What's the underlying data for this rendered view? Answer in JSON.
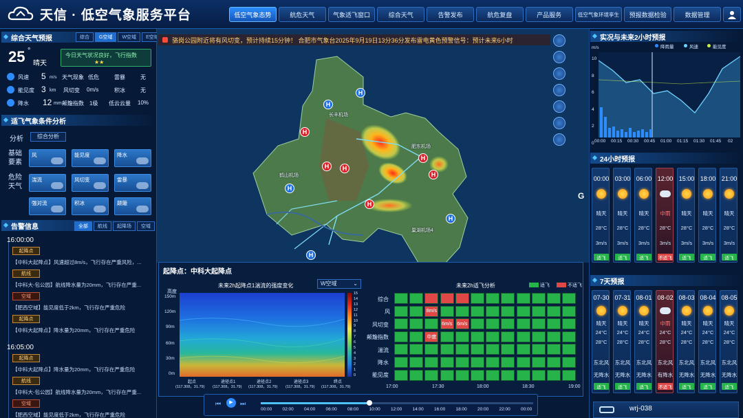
{
  "header": {
    "title": "天信 · 低空气象服务平台",
    "nav": [
      "低空气象态势",
      "航危天气",
      "气象适飞窗口",
      "综合天气",
      "告警发布",
      "航危复盘",
      "产品服务",
      "低空气象环境孪生",
      "预报数据检验",
      "数据管理"
    ],
    "active_index": 0
  },
  "left": {
    "forecast": {
      "title": "综合天气预报",
      "filters": [
        "综合",
        "G空域",
        "W空域",
        "E空域"
      ],
      "temp": "25",
      "temp_unit": "°",
      "condition": "晴天",
      "banner": "今日天气状况良好，飞行指数",
      "metrics": [
        {
          "icon": "wind-icon",
          "label": "风速",
          "value": "5",
          "unit": "m/s"
        },
        {
          "icon": "eye-icon",
          "label": "能见度",
          "value": "3",
          "unit": "km"
        },
        {
          "icon": "rain-icon",
          "label": "降水",
          "value": "12",
          "unit": "mm"
        }
      ],
      "table": [
        [
          "天气现象",
          "低危",
          "雷暴",
          "无"
        ],
        [
          "风切变",
          "0m/s",
          "积冰",
          "无"
        ],
        [
          "颠簸指数",
          "1级",
          "低云云量",
          "10%"
        ]
      ]
    },
    "suitability": {
      "title": "适飞气象条件分析",
      "analysis_label": "分析",
      "analysis_value": "综合分析",
      "basic_label": "基础要素",
      "danger_label": "危险天气",
      "basic": [
        "风",
        "能见度",
        "降水"
      ],
      "danger": [
        "湍流",
        "风切变",
        "雷暴",
        "强对流",
        "积冰",
        "颠簸"
      ]
    },
    "alerts": {
      "title": "告警信息",
      "filters": [
        "全部",
        "航线",
        "起降场",
        "空域"
      ],
      "groups": [
        {
          "time": "16:00:00",
          "items": [
            {
              "tag": "起降点",
              "text": "【中科大起降点】风速超过8m/s，飞行存在严重风险，..."
            },
            {
              "tag": "航线",
              "text": "【中科大-包公园】航线降水量为20mm，飞行存在严重..."
            },
            {
              "tag": "空域",
              "text": "【肥西空域】能见度低于2km，飞行存在严重危险"
            },
            {
              "tag": "起降点",
              "text": "【中科大起降点】降水量为20mm，飞行存在严重危险"
            }
          ]
        },
        {
          "time": "16:05:00",
          "items": [
            {
              "tag": "起降点",
              "text": "【中科大起降点】降水量为20mm，飞行存在严重危险"
            },
            {
              "tag": "航线",
              "text": "【中科大-包公园】航线降水量为20mm，飞行存在严重..."
            },
            {
              "tag": "空域",
              "text": "【肥西空域】能见度低于2km，飞行存在严重危险"
            }
          ]
        }
      ]
    }
  },
  "map": {
    "ticker": "骆岗公园附近将有风切变，预计持续15分钟！      合肥市气象台2025年9月19日13分36分发布雷电黄色预警信号：预计未来6小时",
    "labels": [
      {
        "text": "长丰机场"
      },
      {
        "text": "肥东机场"
      },
      {
        "text": "鹤山机场"
      },
      {
        "text": "巢湖机场4"
      }
    ],
    "side_letter": "G"
  },
  "analysis": {
    "title": "起降点：中科大起降点",
    "left_title": "未来2h起降点1湍流的强度变化",
    "airspace_select": "W空域",
    "y_axis_label": "高度",
    "y_ticks": [
      "150m",
      "120m",
      "90m",
      "60m",
      "30m",
      "0m"
    ],
    "colorbar": [
      "15",
      "14",
      "13",
      "12",
      "11",
      "10",
      "9",
      "8",
      "7",
      "6",
      "5",
      "4",
      "3",
      "2",
      "1",
      "0"
    ],
    "x_ticks": [
      "起点",
      "途径点1",
      "途径点2",
      "途径点3",
      "终点"
    ],
    "x_ticks_sub": "(117.308，31.79)",
    "right_title": "未来2h适飞分析",
    "legend": [
      {
        "label": "适飞",
        "color": "#26b34a"
      },
      {
        "label": "不适飞",
        "color": "#e04848"
      }
    ],
    "rows": [
      "综合",
      "风",
      "风切变",
      "颠簸指数",
      "湍流",
      "降水",
      "能见度"
    ],
    "time_ticks": [
      "17:00",
      "17:30",
      "18:00",
      "18:30",
      "19:00"
    ],
    "grid": [
      [
        0,
        0,
        1,
        1,
        1,
        0,
        0,
        0,
        0,
        0,
        0,
        0
      ],
      [
        0,
        0,
        1,
        0,
        0,
        0,
        0,
        0,
        0,
        0,
        0,
        0
      ],
      [
        0,
        0,
        0,
        1,
        1,
        0,
        0,
        0,
        0,
        0,
        0,
        0
      ],
      [
        0,
        0,
        1,
        0,
        0,
        0,
        0,
        0,
        0,
        0,
        0,
        0
      ],
      [
        0,
        0,
        0,
        0,
        0,
        0,
        0,
        0,
        0,
        0,
        0,
        0
      ],
      [
        0,
        0,
        0,
        0,
        0,
        0,
        0,
        0,
        0,
        0,
        0,
        0
      ],
      [
        0,
        0,
        0,
        0,
        0,
        0,
        0,
        0,
        0,
        0,
        0,
        0
      ]
    ],
    "cell_labels": [
      {
        "r": 1,
        "c": 2,
        "t": "8m/s"
      },
      {
        "r": 2,
        "c": 3,
        "t": "6m/s"
      },
      {
        "r": 2,
        "c": 4,
        "t": "6m/s"
      },
      {
        "r": 3,
        "c": 2,
        "t": "中度"
      }
    ]
  },
  "timeline": {
    "ticks": [
      "00:00",
      "02:00",
      "04:00",
      "06:00",
      "08:00",
      "10:00",
      "12:00",
      "14:00",
      "16:00",
      "18:00",
      "20:00",
      "22:00",
      "00:00"
    ],
    "progress": 0.4
  },
  "right": {
    "realtime": {
      "title": "实况与未来2小时预报",
      "unit": "m/s",
      "legend": [
        "降雨量",
        "风速",
        "能见度"
      ],
      "y_ticks": [
        "10",
        "8",
        "6",
        "4",
        "2",
        "0"
      ],
      "x_ticks": [
        "00:00",
        "00:15",
        "00:30",
        "00:45",
        "01:00",
        "01:15",
        "01:30",
        "01:45",
        "02"
      ],
      "colors": {
        "rain": "#2f8cff",
        "wind": "#6fd3ff",
        "vis": "#c8f04a"
      }
    },
    "hourly": {
      "title": "24小时预报",
      "items": [
        {
          "time": "00:00",
          "wx": "晴天",
          "temp": "28°C",
          "wind": "3m/s",
          "ok": "适飞",
          "bad": false
        },
        {
          "time": "03:00",
          "wx": "晴天",
          "temp": "28°C",
          "wind": "3m/s",
          "ok": "适飞",
          "bad": false
        },
        {
          "time": "06:00",
          "wx": "晴天",
          "temp": "28°C",
          "wind": "3m/s",
          "ok": "适飞",
          "bad": false
        },
        {
          "time": "12:00",
          "wx": "中雨",
          "temp": "28°C",
          "wind": "3m/s",
          "ok": "不适飞",
          "bad": true
        },
        {
          "time": "15:00",
          "wx": "晴天",
          "temp": "28°C",
          "wind": "3m/s",
          "ok": "适飞",
          "bad": false
        },
        {
          "time": "18:00",
          "wx": "晴天",
          "temp": "28°C",
          "wind": "3m/s",
          "ok": "适飞",
          "bad": false
        },
        {
          "time": "21:00",
          "wx": "晴天",
          "temp": "28°C",
          "wind": "3m/s",
          "ok": "适飞",
          "bad": false
        }
      ]
    },
    "daily": {
      "title": "7天预报",
      "items": [
        {
          "date": "07-30",
          "wx": "晴天",
          "hi": "24°C",
          "lo": "28°C",
          "wind": "东北风",
          "rain": "无降水",
          "ok": "适飞",
          "bad": false
        },
        {
          "date": "07-31",
          "wx": "晴天",
          "hi": "24°C",
          "lo": "28°C",
          "wind": "东北风",
          "rain": "无降水",
          "ok": "适飞",
          "bad": false
        },
        {
          "date": "08-01",
          "wx": "晴天",
          "hi": "24°C",
          "lo": "28°C",
          "wind": "东北风",
          "rain": "无降水",
          "ok": "适飞",
          "bad": false
        },
        {
          "date": "08-02",
          "wx": "中雨",
          "hi": "24°C",
          "lo": "28°C",
          "wind": "东北风",
          "rain": "有降水",
          "ok": "不适飞",
          "bad": true
        },
        {
          "date": "08-03",
          "wx": "晴天",
          "hi": "24°C",
          "lo": "28°C",
          "wind": "东北风",
          "rain": "无降水",
          "ok": "适飞",
          "bad": false
        },
        {
          "date": "08-04",
          "wx": "晴天",
          "hi": "24°C",
          "lo": "28°C",
          "wind": "东北风",
          "rain": "无降水",
          "ok": "适飞",
          "bad": false
        },
        {
          "date": "08-05",
          "wx": "晴天",
          "hi": "24°C",
          "lo": "28°C",
          "wind": "东北风",
          "rain": "无降水",
          "ok": "适飞",
          "bad": false
        }
      ]
    },
    "drone": {
      "id": "wrj-038"
    }
  }
}
